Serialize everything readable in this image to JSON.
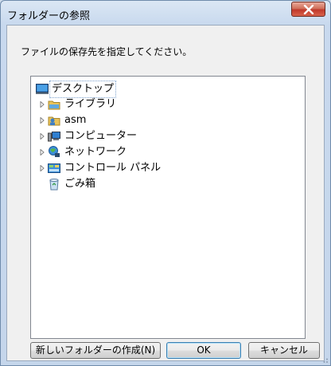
{
  "window": {
    "title": "フォルダーの参照"
  },
  "dialog": {
    "instruction": "ファイルの保存先を指定してください。"
  },
  "tree": {
    "items": [
      {
        "label": "デスクトップ",
        "icon": "desktop-icon",
        "expandable": false,
        "selected": true
      },
      {
        "label": "ライブラリ",
        "icon": "library-icon",
        "expandable": true,
        "selected": false
      },
      {
        "label": "asm",
        "icon": "user-folder-icon",
        "expandable": true,
        "selected": false
      },
      {
        "label": "コンピューター",
        "icon": "computer-icon",
        "expandable": true,
        "selected": false
      },
      {
        "label": "ネットワーク",
        "icon": "network-icon",
        "expandable": true,
        "selected": false
      },
      {
        "label": "コントロール パネル",
        "icon": "control-panel-icon",
        "expandable": true,
        "selected": false
      },
      {
        "label": "ごみ箱",
        "icon": "recycle-bin-icon",
        "expandable": false,
        "selected": false
      }
    ]
  },
  "buttons": {
    "new_folder": "新しいフォルダーの作成(N)",
    "ok": "OK",
    "cancel": "キャンセル"
  },
  "colors": {
    "close_button": "#c0392b",
    "frame": "#c5d6eb",
    "selection_border": "#7da2ce"
  }
}
